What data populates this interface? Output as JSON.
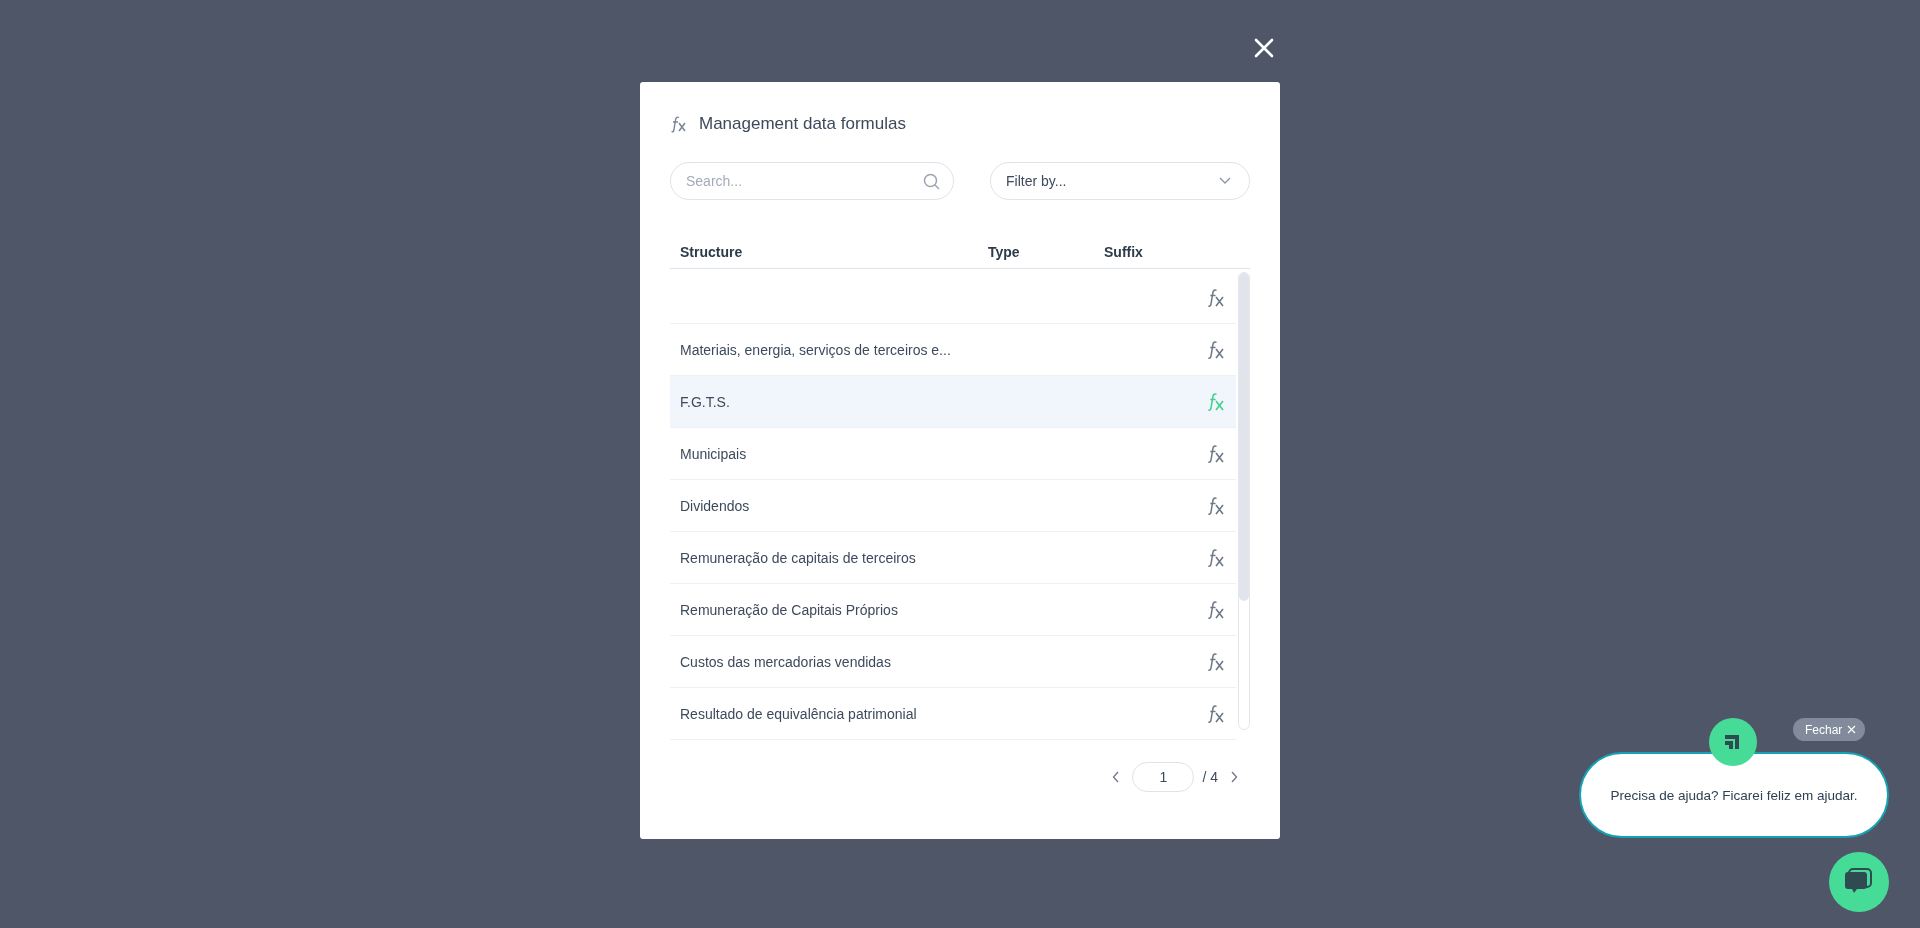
{
  "modal": {
    "title": "Management data formulas",
    "search": {
      "placeholder": "Search..."
    },
    "filter": {
      "placeholder": "Filter by..."
    },
    "columns": [
      "Structure",
      "Type",
      "Suffix"
    ],
    "rows": [
      {
        "selected": false
      },
      {
        "structure": "Materiais, energia, serviços de terceiros e...",
        "selected": false
      },
      {
        "structure": "F.G.T.S.",
        "selected": true
      },
      {
        "structure": "Municipais",
        "selected": false
      },
      {
        "structure": "Dividendos",
        "selected": false
      },
      {
        "structure": "Remuneração de capitais de terceiros",
        "selected": false
      },
      {
        "structure": "Remuneração de Capitais Próprios",
        "selected": false
      },
      {
        "structure": "Custos das mercadorias vendidas",
        "selected": false
      },
      {
        "structure": "Resultado de equivalência patrimonial",
        "selected": false
      }
    ],
    "pagination": {
      "page": "1",
      "total": "/ 4"
    }
  },
  "chat": {
    "close_label": "Fechar",
    "message": "Precisa de ajuda? Ficarei feliz em ajudar."
  }
}
